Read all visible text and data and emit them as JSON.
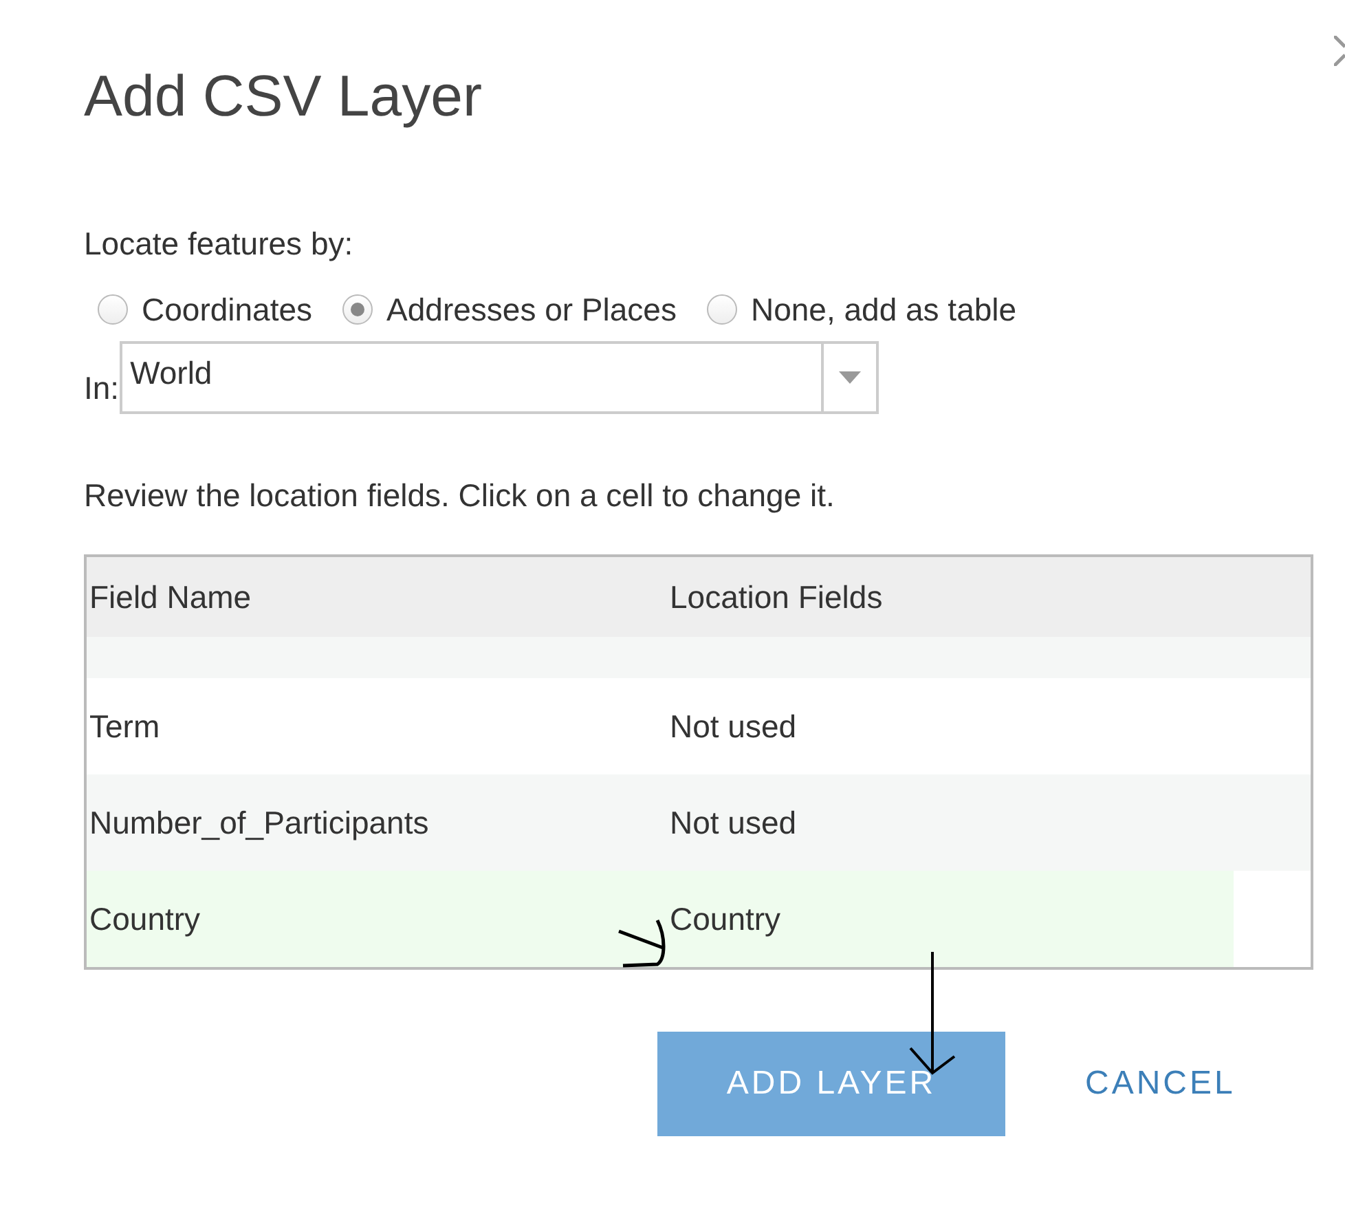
{
  "dialog": {
    "title": "Add CSV Layer"
  },
  "locate": {
    "label": "Locate features by:",
    "options": [
      {
        "label": "Coordinates",
        "selected": false
      },
      {
        "label": "Addresses or Places",
        "selected": true
      },
      {
        "label": "None, add as table",
        "selected": false
      }
    ]
  },
  "region": {
    "label": "In:",
    "value": "World"
  },
  "instructions": "Review the location fields. Click on a cell to change it.",
  "table": {
    "columns": [
      "Field Name",
      "Location Fields"
    ],
    "rows": [
      {
        "field": "Term",
        "location": "Not used",
        "selected": false
      },
      {
        "field": "Number_of_Participants",
        "location": "Not used",
        "selected": false
      },
      {
        "field": "Country",
        "location": "Country",
        "selected": true
      }
    ]
  },
  "buttons": [
    {
      "label": "ADD LAYER",
      "kind": "primary"
    },
    {
      "label": "CANCEL",
      "kind": "link"
    }
  ]
}
